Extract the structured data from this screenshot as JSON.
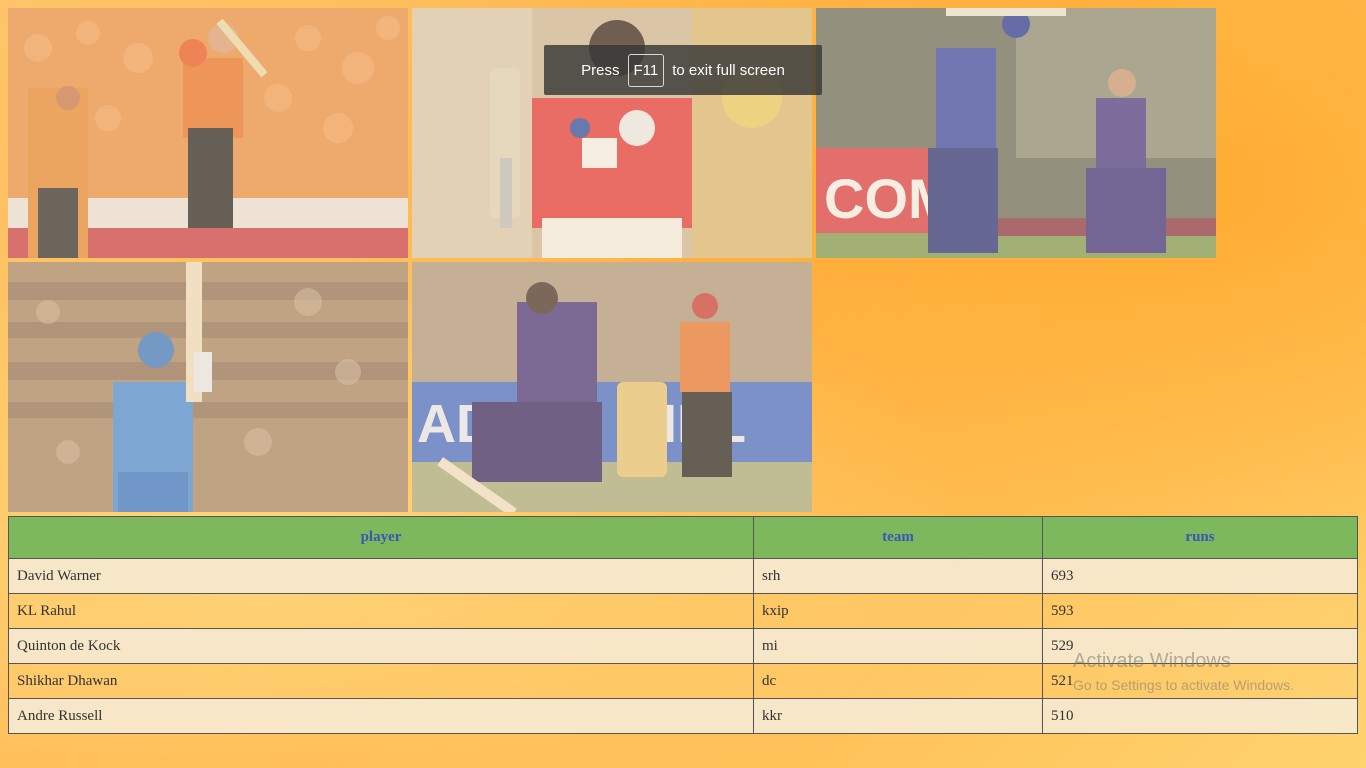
{
  "fullscreen_notice": {
    "prefix": "Press",
    "key": "F11",
    "suffix": "to exit full screen"
  },
  "gallery": [
    {
      "name": "photo-david-warner",
      "alt": "David Warner celebrating"
    },
    {
      "name": "photo-kl-rahul",
      "alt": "KL Rahul batting"
    },
    {
      "name": "photo-quinton-de-kock",
      "alt": "Quinton de Kock batting"
    },
    {
      "name": "photo-shikhar-dhawan",
      "alt": "Shikhar Dhawan raising bat"
    },
    {
      "name": "photo-andre-russell",
      "alt": "Andre Russell batting"
    }
  ],
  "table": {
    "headers": [
      "player",
      "team",
      "runs"
    ],
    "rows": [
      [
        "David Warner",
        "srh",
        "693"
      ],
      [
        "KL Rahul",
        "kxip",
        "593"
      ],
      [
        "Quinton de Kock",
        "mi",
        "529"
      ],
      [
        "Shikhar Dhawan",
        "dc",
        "521"
      ],
      [
        "Andre Russell",
        "kkr",
        "510"
      ]
    ]
  },
  "watermark": {
    "title": "Activate Windows",
    "subtitle": "Go to Settings to activate Windows."
  },
  "colors": {
    "header_bg": "#7db85c",
    "header_text": "#3a56b8",
    "background": "#ffb347"
  }
}
